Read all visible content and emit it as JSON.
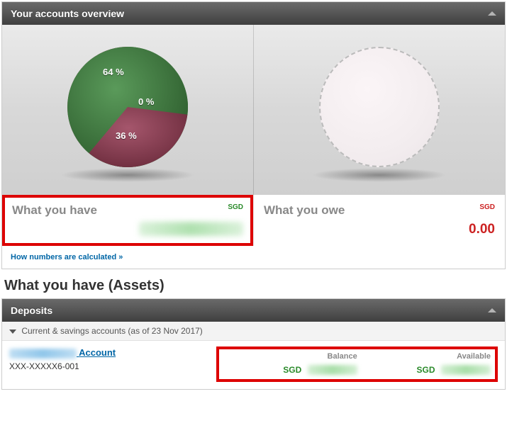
{
  "overview": {
    "title": "Your accounts overview",
    "have": {
      "label": "What you have",
      "currency": "SGD"
    },
    "owe": {
      "label": "What you owe",
      "currency": "SGD",
      "amount": "0.00"
    },
    "calc_link": "How numbers are calculated »"
  },
  "assets": {
    "heading": "What you have (Assets)",
    "deposits_title": "Deposits",
    "sub_label": "Current & savings accounts (as of 23 Nov 2017)",
    "account": {
      "link_suffix": "Account",
      "number": "XXX-XXXXX6-001",
      "balance_label": "Balance",
      "available_label": "Available",
      "currency": "SGD"
    }
  },
  "chart_data": {
    "type": "pie",
    "title": "What you have",
    "slices": [
      {
        "label": "64 %",
        "value": 64,
        "color": "#3b7a3b"
      },
      {
        "label": "36 %",
        "value": 36,
        "color": "#8e3a4e"
      },
      {
        "label": "0 %",
        "value": 0,
        "color": "#333333"
      }
    ]
  }
}
